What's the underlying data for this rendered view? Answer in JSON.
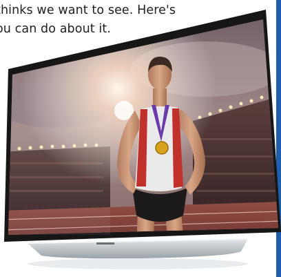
{
  "article": {
    "line1": "thinks we want to see. Here's",
    "line2": "ou can do about it."
  },
  "image": {
    "subject": "flat-screen-tv",
    "scene": "stadium-athlete",
    "colors": {
      "bezel": "#1a1a1a",
      "stand": "#c9cdd2",
      "accent_strip": "#1f5fae",
      "medal": "#d9a21b",
      "ribbon": "#6a3aa8"
    }
  }
}
